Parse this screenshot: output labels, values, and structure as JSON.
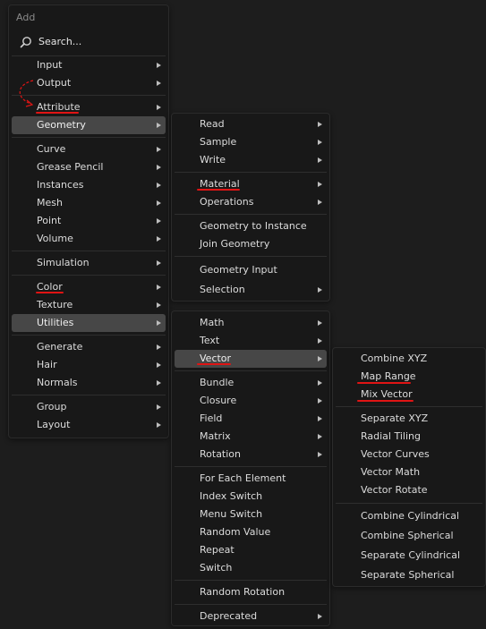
{
  "add_menu": {
    "title": "Add",
    "search_label": "Search...",
    "items": [
      "Input",
      "Output",
      "Attribute",
      "Geometry",
      "Curve",
      "Grease Pencil",
      "Instances",
      "Mesh",
      "Point",
      "Volume",
      "Simulation",
      "Color",
      "Texture",
      "Utilities",
      "Generate",
      "Hair",
      "Normals",
      "Group",
      "Layout"
    ]
  },
  "geometry_menu": {
    "items": [
      "Read",
      "Sample",
      "Write",
      "Material",
      "Operations",
      "Geometry to Instance",
      "Join Geometry",
      "Geometry Input",
      "Selection"
    ]
  },
  "utilities_menu": {
    "items": [
      "Math",
      "Text",
      "Vector",
      "Bundle",
      "Closure",
      "Field",
      "Matrix",
      "Rotation",
      "For Each Element",
      "Index Switch",
      "Menu Switch",
      "Random Value",
      "Repeat",
      "Switch",
      "Random Rotation",
      "Deprecated"
    ]
  },
  "vector_menu": {
    "items": [
      "Combine XYZ",
      "Map Range",
      "Mix Vector",
      "Separate XYZ",
      "Radial Tiling",
      "Vector Curves",
      "Vector Math",
      "Vector Rotate",
      "Combine Cylindrical",
      "Combine Spherical",
      "Separate Cylindrical",
      "Separate Spherical"
    ]
  },
  "colors": {
    "menu_bg": "#181818",
    "highlight": "#474747",
    "annotation_red": "#e01414"
  }
}
